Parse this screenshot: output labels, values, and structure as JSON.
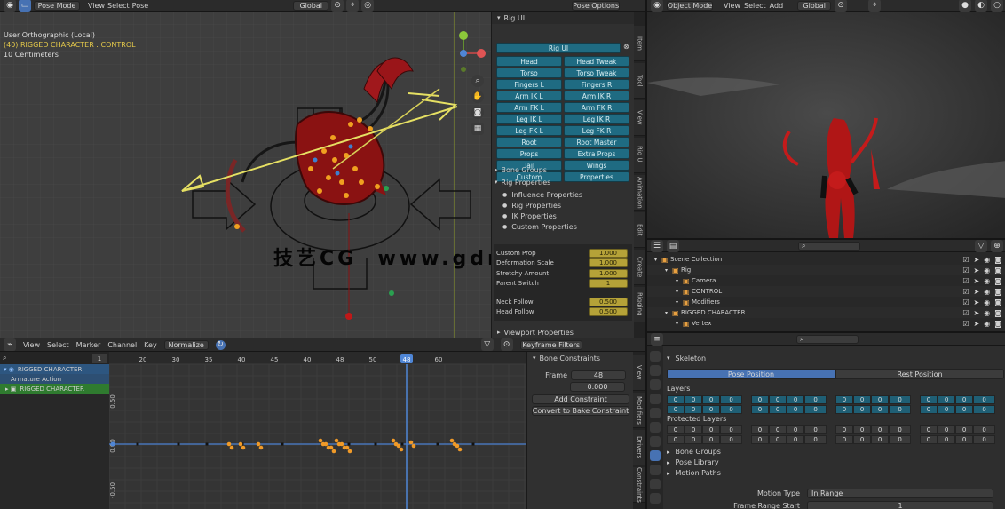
{
  "viewport": {
    "header": {
      "mode": "Pose Mode",
      "menus": [
        "View",
        "Select",
        "Pose"
      ],
      "orientation": "Global",
      "overlay_label": "Pose Options"
    },
    "info_lines": [
      "User Orthographic (Local)",
      "(40) RIGGED CHARACTER : CONTROL",
      "10 Centimeters"
    ],
    "n_panel": {
      "title": "Rig UI",
      "top_button": "Rig UI",
      "teal_buttons": [
        "Head",
        "Head Tweak",
        "Torso",
        "Torso Tweak",
        "Fingers L",
        "Fingers R",
        "Arm IK L",
        "Arm IK R",
        "Arm FK L",
        "Arm FK R",
        "Leg IK L",
        "Leg IK R",
        "Leg FK L",
        "Leg FK R",
        "Root",
        "Root Master",
        "Props",
        "Extra Props",
        "Tail",
        "Wings",
        "Custom",
        "Properties"
      ],
      "sections": [
        "Bone Groups",
        "Rig Properties"
      ],
      "props": [
        "Influence Properties",
        "Rig Properties",
        "IK Properties",
        "Custom Properties"
      ],
      "sliders": [
        {
          "label": "Custom Prop",
          "value": "1.000"
        },
        {
          "label": "Deformation Scale",
          "value": "1.000"
        },
        {
          "label": "Stretchy Amount",
          "value": "1.000"
        },
        {
          "label": "Parent Switch",
          "value": "1"
        },
        {
          "label": "Neck Follow",
          "value": "0.500"
        },
        {
          "label": "Head Follow",
          "value": "0.500"
        }
      ],
      "footer": "Viewport Properties",
      "tabs": [
        "Item",
        "Tool",
        "View",
        "Rig UI",
        "Animation",
        "Edit",
        "Create",
        "Rigging"
      ]
    },
    "watermark": "技艺CG  www.gdnxxfb.cn"
  },
  "graph": {
    "header": {
      "menus": [
        "View",
        "Select",
        "Marker",
        "Channel",
        "Key"
      ],
      "mode_label": "Normalize",
      "filter_label": "Keyframe Filters"
    },
    "frames": [
      "20",
      "30",
      "35",
      "40",
      "45",
      "40",
      "48",
      "50",
      "55",
      "60"
    ],
    "current_frame": "48",
    "frame_field": "1",
    "channels": [
      "RIGGED CHARACTER",
      "Armature Action",
      "RIGGED CHARACTER"
    ],
    "y_labels": [
      "0.50",
      "0.00",
      "-0.50"
    ],
    "sidebar": {
      "section": "Bone Constraints",
      "fields": [
        {
          "label": "Frame",
          "value": "48"
        },
        {
          "label": "",
          "value": "0.000"
        }
      ],
      "buttons": [
        "Add Constraint",
        "Convert to Bake Constraint"
      ],
      "tabs": [
        "View",
        "Modifiers",
        "Drivers",
        "Constraints"
      ]
    }
  },
  "render": {
    "header": {
      "mode": "Object Mode",
      "menus": [
        "View",
        "Select",
        "Add"
      ],
      "orientation": "Global"
    }
  },
  "outliner": {
    "search_placeholder": "",
    "rows": [
      {
        "label": "Scene Collection",
        "indent": 0
      },
      {
        "label": "Rig",
        "indent": 1
      },
      {
        "label": "Camera",
        "indent": 2
      },
      {
        "label": "CONTROL",
        "indent": 2
      },
      {
        "label": "Modifiers",
        "indent": 2
      },
      {
        "label": "RIGGED CHARACTER",
        "indent": 1
      },
      {
        "label": "Vertex",
        "indent": 2
      }
    ]
  },
  "properties": {
    "section": "Skeleton",
    "buttons": [
      "Pose Position",
      "Rest Position"
    ],
    "layers_label": "Layers",
    "protected_label": "Protected Layers",
    "layer_values": [
      "0",
      "0",
      "0",
      "0",
      "0",
      "0",
      "0",
      "0",
      "0",
      "0",
      "0",
      "0",
      "0",
      "0",
      "0",
      "0"
    ],
    "subsections": [
      "Bone Groups",
      "Pose Library",
      "Motion Paths"
    ],
    "fields": [
      {
        "label": "Motion Type",
        "value": "In Range"
      },
      {
        "label": "Frame Range Start",
        "value": "1"
      }
    ]
  }
}
